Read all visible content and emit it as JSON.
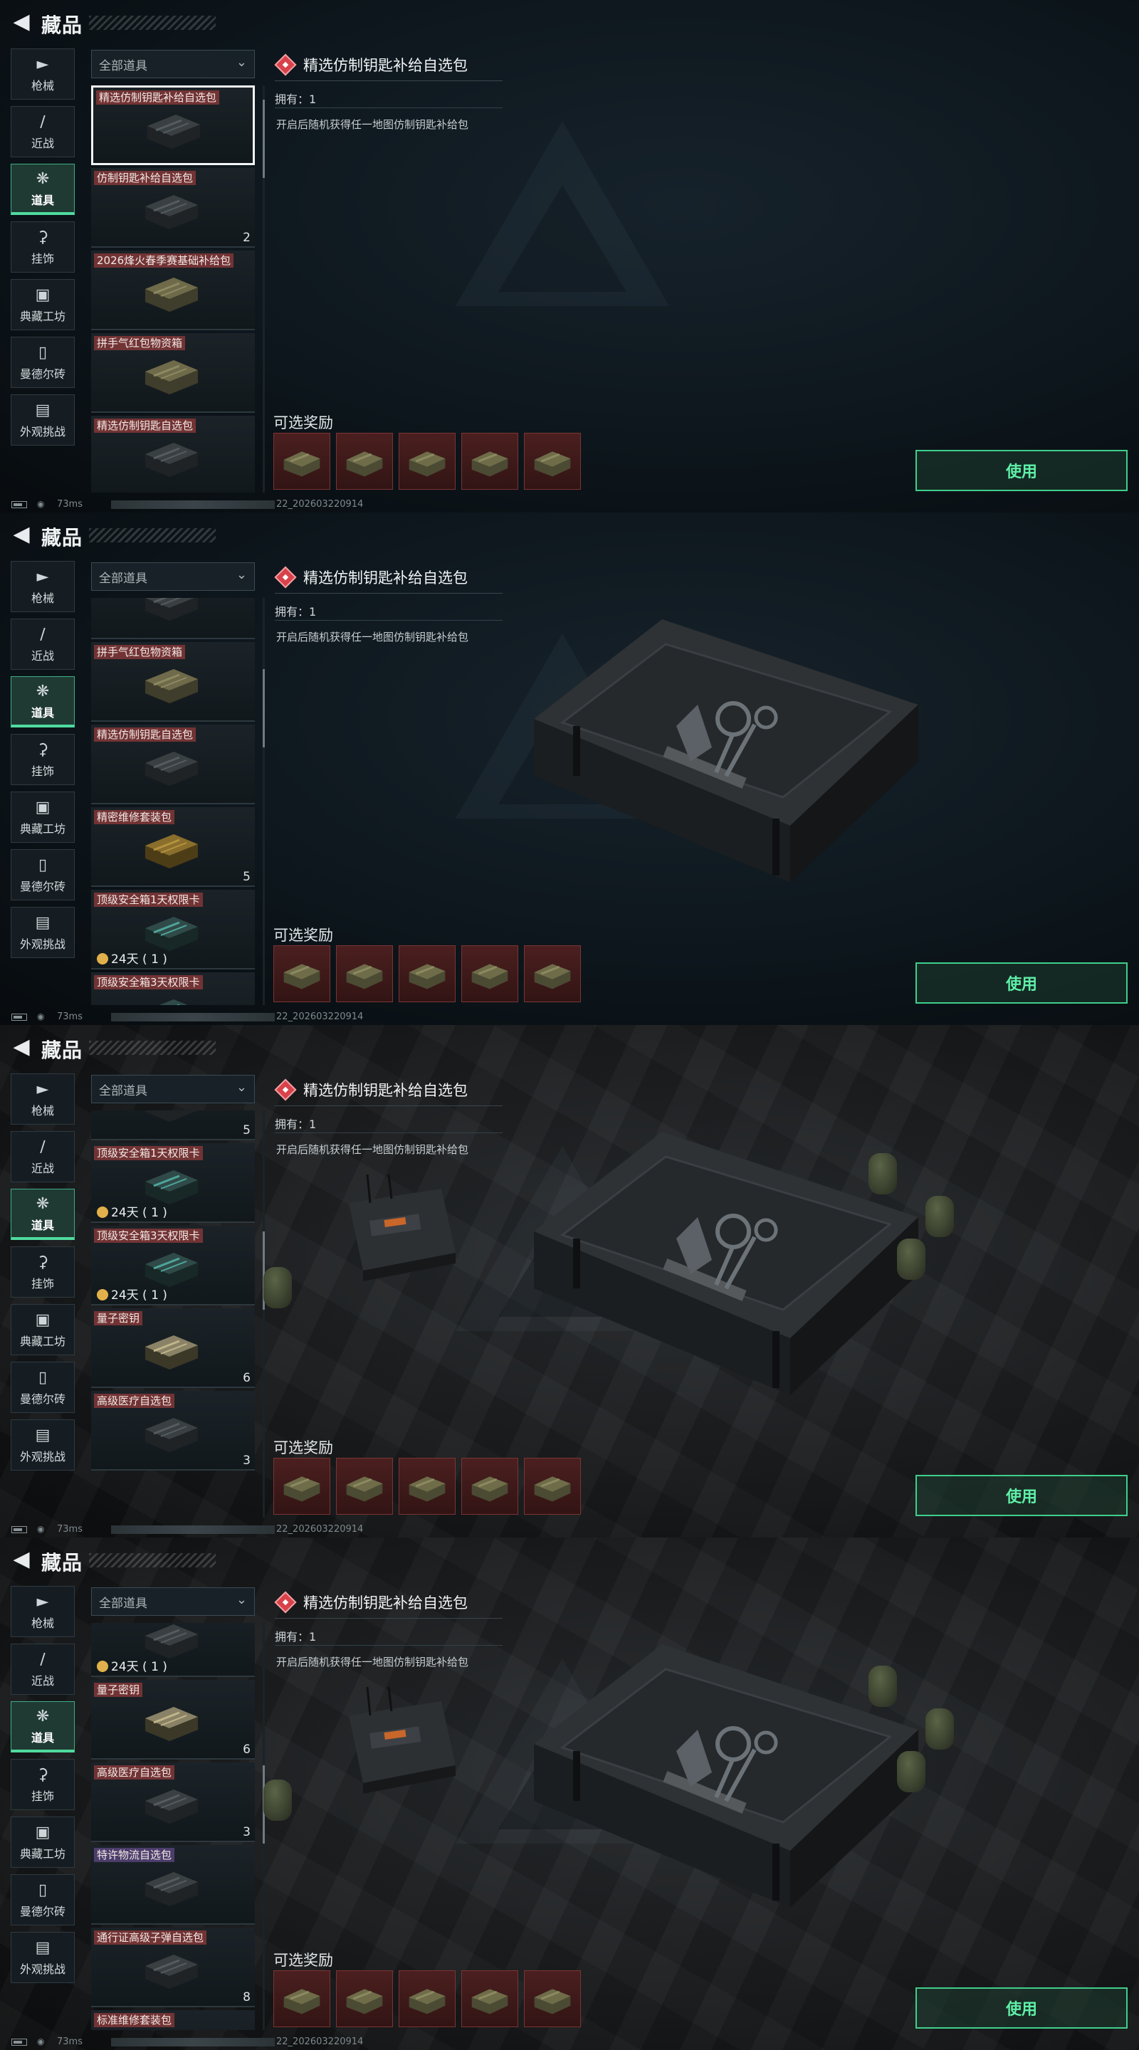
{
  "header": {
    "title": "藏品",
    "back_icon": "back-arrow-icon"
  },
  "sidebar": [
    {
      "label": "枪械",
      "icon": "gun-icon"
    },
    {
      "label": "近战",
      "icon": "knife-icon"
    },
    {
      "label": "道具",
      "icon": "items-icon",
      "active": true
    },
    {
      "label": "挂饰",
      "icon": "charm-icon"
    },
    {
      "label": "典藏工坊",
      "icon": "workshop-icon"
    },
    {
      "label": "曼德尔砖",
      "icon": "brick-icon"
    },
    {
      "label": "外观挑战",
      "icon": "challenge-icon"
    }
  ],
  "filter": {
    "label": "全部道具"
  },
  "detail": {
    "title": "精选仿制钥匙补给自选包",
    "owned": "拥有：1",
    "description": "开启后随机获得任一地图仿制钥匙补给包",
    "rewards_label": "可选奖励",
    "use_button": "使用"
  },
  "status": {
    "ping": "73ms",
    "build": "22_202603220914"
  },
  "panels": [
    {
      "cards": [
        {
          "name": "精选仿制钥匙补给自选包",
          "count": "",
          "selected": true
        },
        {
          "name": "仿制钥匙补给自选包",
          "count": "2"
        },
        {
          "name": "2026烽火春季赛基础补给包",
          "count": ""
        },
        {
          "name": "拼手气红包物资箱",
          "count": ""
        },
        {
          "name": "精选仿制钥匙自选包",
          "count": ""
        }
      ]
    },
    {
      "cards": [
        {
          "name": "",
          "count": ""
        },
        {
          "name": "拼手气红包物资箱",
          "count": ""
        },
        {
          "name": "精选仿制钥匙自选包",
          "count": ""
        },
        {
          "name": "精密维修套装包",
          "count": "5"
        },
        {
          "name": "顶级安全箱1天权限卡",
          "count": "",
          "timer": "24天 ( 1 )"
        },
        {
          "name": "顶级安全箱3天权限卡",
          "count": ""
        }
      ]
    },
    {
      "cards": [
        {
          "name": "",
          "count": "5"
        },
        {
          "name": "顶级安全箱1天权限卡",
          "count": "",
          "timer": "24天 ( 1 )"
        },
        {
          "name": "顶级安全箱3天权限卡",
          "count": "",
          "timer": "24天 ( 1 )"
        },
        {
          "name": "量子密钥",
          "count": "6"
        },
        {
          "name": "高级医疗自选包",
          "count": "3"
        }
      ]
    },
    {
      "cards": [
        {
          "name": "",
          "count": "",
          "timer": "24天 ( 1 )"
        },
        {
          "name": "量子密钥",
          "count": "6"
        },
        {
          "name": "高级医疗自选包",
          "count": "3"
        },
        {
          "name": "特许物流自选包",
          "count": "",
          "purple": true
        },
        {
          "name": "通行证高级子弹自选包",
          "count": "8"
        },
        {
          "name": "标准维修套装包",
          "count": ""
        }
      ]
    }
  ]
}
